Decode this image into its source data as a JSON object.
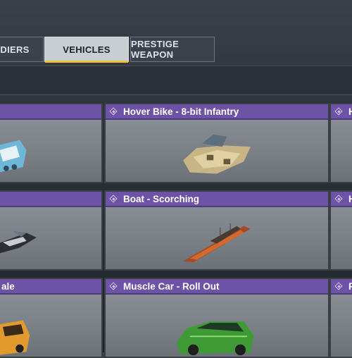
{
  "tabs": [
    {
      "label": "DIERS"
    },
    {
      "label": "VEHICLES"
    },
    {
      "label": "PRESTIGE WEAPON"
    }
  ],
  "cards": [
    {
      "title": "",
      "icon": "diamond-icon"
    },
    {
      "title": "Hover Bike - 8-bit Infantry",
      "icon": "diamond-icon"
    },
    {
      "title": "H",
      "icon": "diamond-icon"
    },
    {
      "title": "",
      "icon": "diamond-icon"
    },
    {
      "title": "Boat - Scorching",
      "icon": "diamond-icon"
    },
    {
      "title": "H",
      "icon": "diamond-icon"
    },
    {
      "title": "ale",
      "icon": "diamond-icon"
    },
    {
      "title": "Muscle Car - Roll Out",
      "icon": "diamond-icon"
    },
    {
      "title": "R",
      "icon": "diamond-icon"
    }
  ],
  "colors": {
    "header_purple": "#6c53a6",
    "active_tab": "#c9ced3",
    "active_tab_underline": "#f0c23a"
  }
}
